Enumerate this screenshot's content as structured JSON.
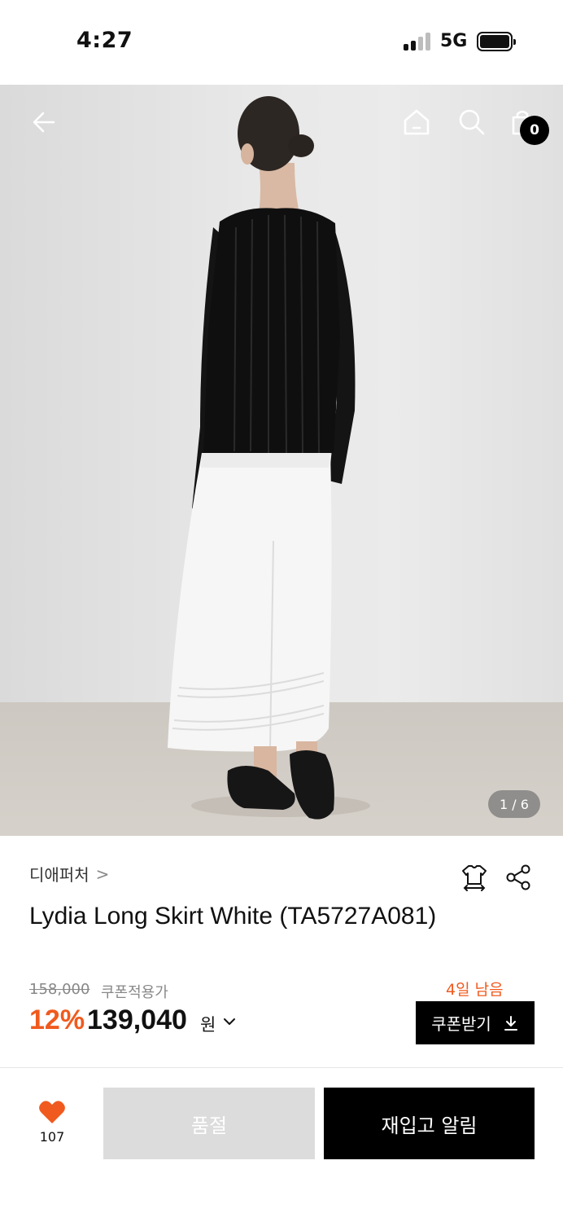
{
  "status_bar": {
    "time": "4:27",
    "network": "5G"
  },
  "header": {
    "back_icon": "arrow-left-icon",
    "home_icon": "home-icon",
    "search_icon": "search-icon",
    "cart_icon": "shopping-bag-icon",
    "cart_count": "0"
  },
  "gallery": {
    "counter": "1 / 6"
  },
  "product": {
    "brand": "디애퍼처",
    "brand_chevron": ">",
    "title": "Lydia Long Skirt White (TA5727A081)",
    "original_price": "158,000",
    "coupon_note": "쿠폰적용가",
    "discount": "12%",
    "price": "139,040",
    "currency": "원"
  },
  "coupon": {
    "days_left": "4일 남음",
    "button_label": "쿠폰받기"
  },
  "actions": {
    "like_count": "107",
    "soldout_label": "품절",
    "restock_label": "재입고 알림"
  },
  "colors": {
    "accent": "#f05a1e",
    "primary": "#000000",
    "disabled": "#dcdcdc"
  }
}
